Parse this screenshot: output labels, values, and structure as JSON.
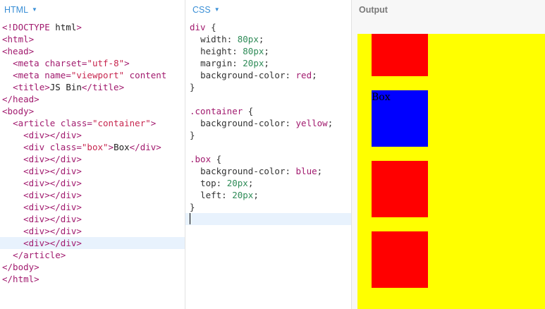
{
  "html_pane": {
    "title": "HTML",
    "lines": [
      "<!DOCTYPE html>",
      "<html>",
      "<head>",
      "  <meta charset=\"utf-8\">",
      "  <meta name=\"viewport\" content",
      "  <title>JS Bin</title>",
      "</head>",
      "<body>",
      "  <article class=\"container\">",
      "    <div></div>",
      "    <div class=\"box\">Box</div>",
      "    <div></div>",
      "    <div></div>",
      "    <div></div>",
      "    <div></div>",
      "    <div></div>",
      "    <div></div>",
      "    <div></div>",
      "    <div></div>",
      "  </article>",
      "</body>",
      "</html>"
    ]
  },
  "css_pane": {
    "title": "CSS",
    "lines": [
      "div {",
      "  width: 80px;",
      "  height: 80px;",
      "  margin: 20px;",
      "  background-color: red;",
      "}",
      "",
      ".container {",
      "  background-color: yellow;",
      "}",
      "",
      ".box {",
      "  background-color: blue;",
      "  top: 20px;",
      "  left: 20px;",
      "}",
      ""
    ]
  },
  "output_pane": {
    "title": "Output",
    "container_color": "#ffff00",
    "boxes": [
      {
        "color": "#ff0000",
        "label": ""
      },
      {
        "color": "#0000ff",
        "label": "Box"
      },
      {
        "color": "#ff0000",
        "label": ""
      },
      {
        "color": "#ff0000",
        "label": ""
      }
    ]
  },
  "colors": {
    "tab_accent": "#3a8fd6",
    "active_line": "#e8f2fd"
  }
}
